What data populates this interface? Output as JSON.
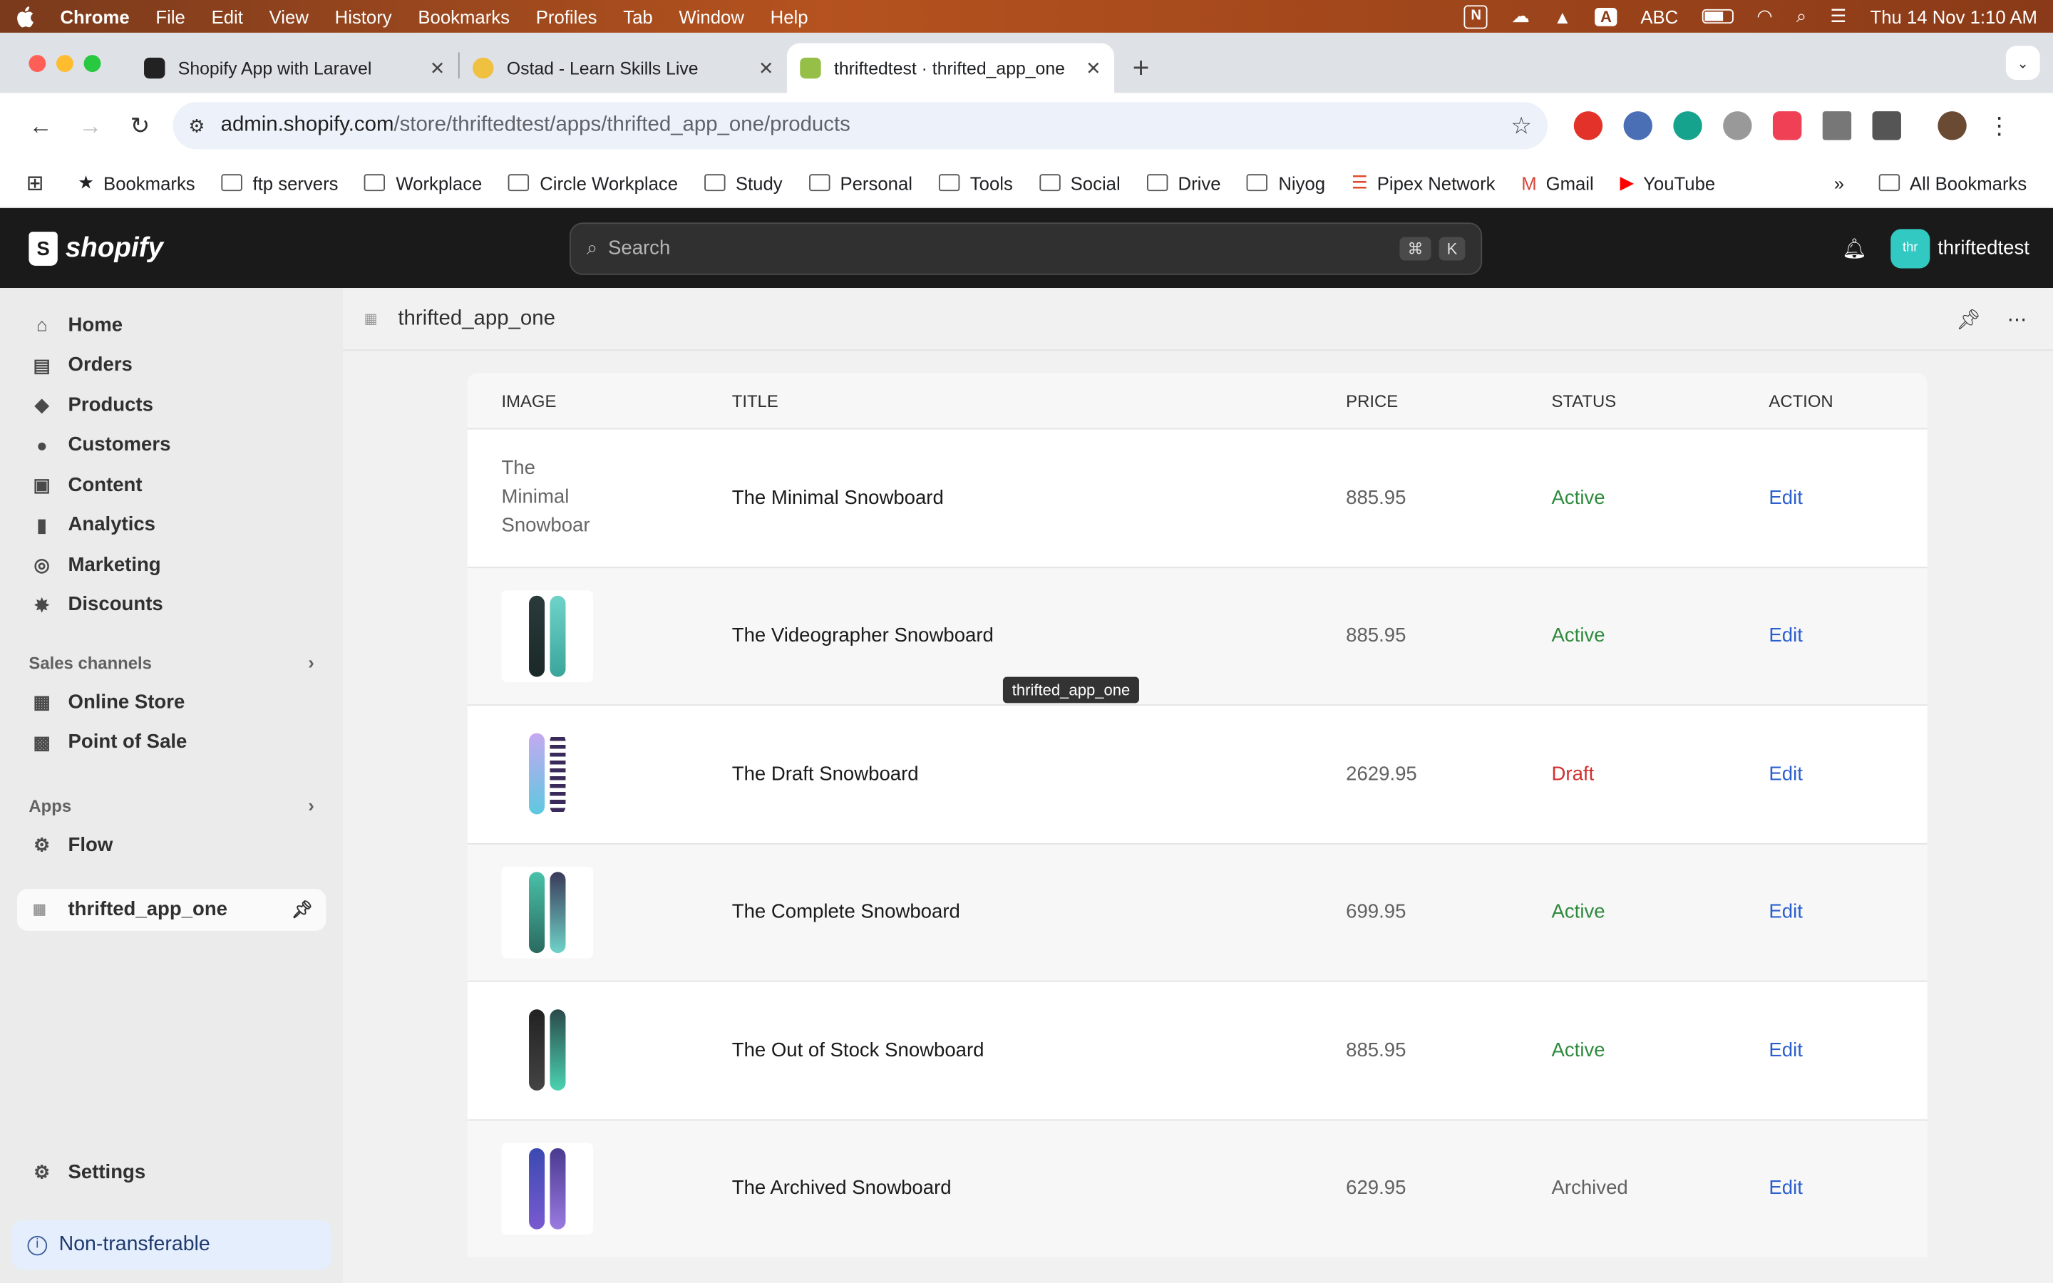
{
  "menubar": {
    "app": "Chrome",
    "items": [
      "File",
      "Edit",
      "View",
      "History",
      "Bookmarks",
      "Profiles",
      "Tab",
      "Window",
      "Help"
    ],
    "input_source": "ABC",
    "clock": "Thu 14 Nov  1:10 AM"
  },
  "tabs": [
    {
      "title": "Shopify App with Laravel",
      "active": false
    },
    {
      "title": "Ostad - Learn Skills Live",
      "active": false
    },
    {
      "title": "thriftedtest · thrifted_app_one",
      "active": true
    }
  ],
  "address": {
    "host": "admin.shopify.com",
    "path": "/store/thriftedtest/apps/thrifted_app_one/products"
  },
  "bookmarks": [
    "Bookmarks",
    "ftp servers",
    "Workplace",
    "Circle Workplace",
    "Study",
    "Personal",
    "Tools",
    "Social",
    "Drive",
    "Niyog",
    "Pipex Network",
    "Gmail",
    "YouTube"
  ],
  "all_bookmarks": "All Bookmarks",
  "shopify": {
    "logo": "shopify",
    "search_placeholder": "Search",
    "kbd1": "⌘",
    "kbd2": "K",
    "avatar_initials": "thr",
    "store_name": "thriftedtest"
  },
  "sidebar": {
    "nav": [
      {
        "label": "Home",
        "icon": "⌂"
      },
      {
        "label": "Orders",
        "icon": "▤"
      },
      {
        "label": "Products",
        "icon": "◆"
      },
      {
        "label": "Customers",
        "icon": "●"
      },
      {
        "label": "Content",
        "icon": "▣"
      },
      {
        "label": "Analytics",
        "icon": "▮"
      },
      {
        "label": "Marketing",
        "icon": "◎"
      },
      {
        "label": "Discounts",
        "icon": "✸"
      }
    ],
    "sales_channels_label": "Sales channels",
    "sales_channels": [
      {
        "label": "Online Store",
        "icon": "▦"
      },
      {
        "label": "Point of Sale",
        "icon": "▩"
      }
    ],
    "apps_label": "Apps",
    "apps": [
      {
        "label": "Flow",
        "icon": "⚙"
      }
    ],
    "pinned_app": "thrifted_app_one",
    "settings": "Settings",
    "non_transferable": "Non-transferable"
  },
  "app_header": {
    "title": "thrifted_app_one"
  },
  "table": {
    "columns": [
      "IMAGE",
      "TITLE",
      "PRICE",
      "STATUS",
      "ACTION"
    ],
    "rows": [
      {
        "title": "The Minimal Snowboard",
        "price": "885.95",
        "status": "Active",
        "action": "Edit",
        "image_alt": "The Minimal Snowboar"
      },
      {
        "title": "The Videographer Snowboard",
        "price": "885.95",
        "status": "Active",
        "action": "Edit"
      },
      {
        "title": "The Draft Snowboard",
        "price": "2629.95",
        "status": "Draft",
        "action": "Edit"
      },
      {
        "title": "The Complete Snowboard",
        "price": "699.95",
        "status": "Active",
        "action": "Edit"
      },
      {
        "title": "The Out of Stock Snowboard",
        "price": "885.95",
        "status": "Active",
        "action": "Edit"
      },
      {
        "title": "The Archived Snowboard",
        "price": "629.95",
        "status": "Archived",
        "action": "Edit"
      }
    ]
  },
  "tooltip": "thrifted_app_one",
  "colors": {
    "active": "#2e8a3d",
    "draft": "#d32f2f",
    "archived": "#616161",
    "link": "#2c5fce",
    "topbar": "#1a1a1a"
  }
}
